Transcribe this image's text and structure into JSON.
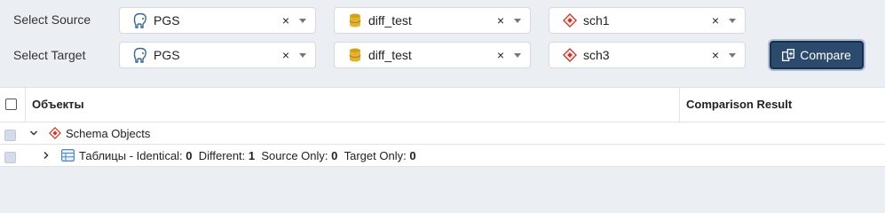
{
  "source": {
    "label": "Select Source",
    "server": {
      "value": "PGS",
      "icon": "postgres-elephant-icon"
    },
    "database": {
      "value": "diff_test",
      "icon": "database-icon"
    },
    "schema": {
      "value": "sch1",
      "icon": "schema-icon"
    }
  },
  "target": {
    "label": "Select Target",
    "server": {
      "value": "PGS",
      "icon": "postgres-elephant-icon"
    },
    "database": {
      "value": "diff_test",
      "icon": "database-icon"
    },
    "schema": {
      "value": "sch3",
      "icon": "schema-icon"
    }
  },
  "clear_glyph": "×",
  "compare_button": {
    "label": "Compare"
  },
  "table": {
    "headers": {
      "objects": "Объекты",
      "result": "Comparison Result"
    },
    "rows": [
      {
        "label": "Schema Objects"
      },
      {
        "label": "Таблицы - Identical:",
        "identical": "0",
        "different_label": "Different:",
        "different": "1",
        "source_only_label": "Source Only:",
        "source_only": "0",
        "target_only_label": "Target Only:",
        "target_only": "0"
      }
    ]
  },
  "colors": {
    "background": "#ebeef3",
    "accent": "#2c4a6e",
    "schema_icon": "#c0392b",
    "database_icon": "#d4a017"
  }
}
